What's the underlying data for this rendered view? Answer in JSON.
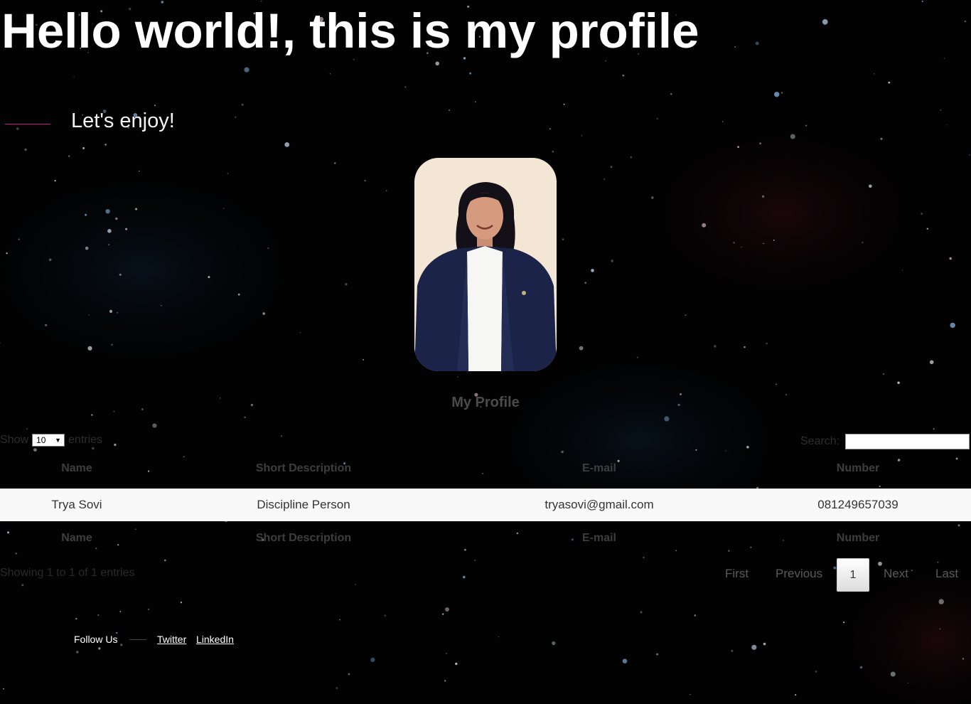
{
  "header": {
    "title": "Hello world!, this is my profile",
    "subtitle": "Let's enjoy!"
  },
  "profile": {
    "heading": "My Profile"
  },
  "table_controls": {
    "show_label": "Show",
    "entries_label": "entries",
    "length_value": "10",
    "search_label": "Search:",
    "search_value": ""
  },
  "table": {
    "columns": [
      "Name",
      "Short Description",
      "E-mail",
      "Number"
    ],
    "rows": [
      {
        "name": "Trya Sovi",
        "description": "Discipline Person",
        "email": "tryasovi@gmail.com",
        "number": "081249657039"
      }
    ]
  },
  "pagination": {
    "info": "Showing 1 to 1 of 1 entries",
    "first": "First",
    "previous": "Previous",
    "current": "1",
    "next": "Next",
    "last": "Last"
  },
  "footer": {
    "follow_label": "Follow Us",
    "links": [
      "Twitter",
      "LinkedIn"
    ]
  },
  "colors": {
    "background": "#000000",
    "accent_line": "#c21a8a",
    "row_background": "#f9f9f9"
  }
}
